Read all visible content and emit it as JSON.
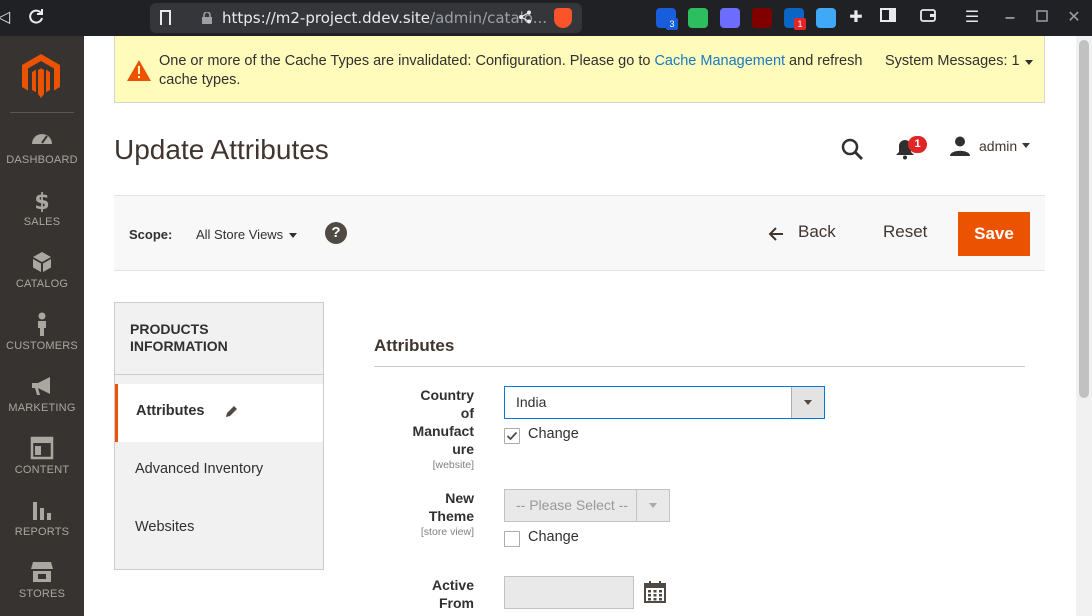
{
  "browser": {
    "url_host": "https://m2-project.ddev.site",
    "url_path": "/admin/catalo...",
    "extensions": [
      {
        "name": "bitwarden-icon",
        "badge": "3",
        "color": "#175ddc"
      },
      {
        "name": "evernote-icon",
        "badge": "",
        "color": "#2dbe60"
      },
      {
        "name": "snowflake-icon",
        "badge": "",
        "color": "#6c6cff"
      },
      {
        "name": "ublock-icon",
        "badge": "",
        "color": "#800000"
      },
      {
        "name": "linkedin-icon",
        "badge": "1",
        "color": "#0a66c2"
      },
      {
        "name": "devtools-icon",
        "badge": "",
        "color": "#3fa9f5"
      }
    ]
  },
  "sidebar": {
    "items": [
      {
        "label": "DASHBOARD",
        "icon": "gauge-icon"
      },
      {
        "label": "SALES",
        "icon": "dollar-icon"
      },
      {
        "label": "CATALOG",
        "icon": "cube-icon"
      },
      {
        "label": "CUSTOMERS",
        "icon": "person-icon"
      },
      {
        "label": "MARKETING",
        "icon": "megaphone-icon"
      },
      {
        "label": "CONTENT",
        "icon": "layout-icon"
      },
      {
        "label": "REPORTS",
        "icon": "bar-chart-icon"
      },
      {
        "label": "STORES",
        "icon": "store-icon"
      }
    ]
  },
  "notice": {
    "text_before": "One or more of the Cache Types are invalidated: Configuration. Please go to ",
    "link": "Cache Management",
    "text_after": " and refresh cache types.",
    "system_messages": "System Messages: 1"
  },
  "header": {
    "title": "Update Attributes",
    "notifications_count": "1",
    "user": "admin"
  },
  "toolbar": {
    "scope_label": "Scope:",
    "scope_value": "All Store Views",
    "help": "?",
    "back_label": "Back",
    "reset_label": "Reset",
    "save_label": "Save"
  },
  "tabs": {
    "heading_line1": "PRODUCTS",
    "heading_line2": "INFORMATION",
    "items": [
      "Attributes",
      "Advanced Inventory",
      "Websites"
    ]
  },
  "form": {
    "section_title": "Attributes",
    "fields": [
      {
        "label_lines": [
          "Country",
          "of",
          "Manufact",
          "ure"
        ],
        "scope": "[website]",
        "value": "India",
        "change_label": "Change",
        "change_checked": true
      },
      {
        "label_lines": [
          "New",
          "Theme"
        ],
        "scope": "[store view]",
        "value": "-- Please Select --",
        "change_label": "Change",
        "change_checked": false
      },
      {
        "label_lines": [
          "Active",
          "From"
        ],
        "value": ""
      }
    ]
  },
  "colors": {
    "accent": "#eb5202",
    "sidebar_bg": "#373330",
    "notice_bg": "#fffbbb",
    "link": "#1979c3"
  }
}
